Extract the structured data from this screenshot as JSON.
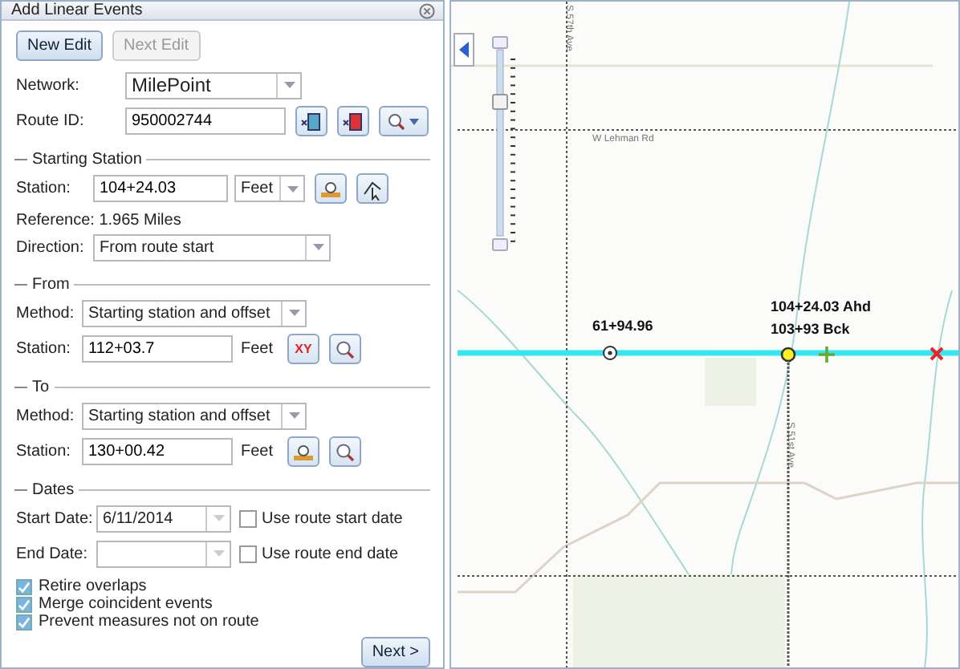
{
  "panel": {
    "title": "Add Linear Events",
    "edit_buttons": [
      {
        "label": "New Edit",
        "disabled": false
      },
      {
        "label": "Next Edit",
        "disabled": true
      }
    ],
    "network": {
      "label": "Network:",
      "value": "MilePoint"
    },
    "route": {
      "label": "Route ID:",
      "value": "950002744"
    },
    "starting_station": {
      "heading": "Starting Station",
      "station_label": "Station:",
      "station": "104+24.03",
      "unit": "Feet",
      "reference": "Reference: 1.965 Miles",
      "direction_label": "Direction:",
      "direction": "From route start"
    },
    "ends": [
      {
        "heading": "From",
        "method_label": "Method:",
        "method": "Starting station and offset",
        "station_label": "Station:",
        "station": "112+03.7",
        "unit": "Feet",
        "tool": "XY"
      },
      {
        "heading": "To",
        "method_label": "Method:",
        "method": "Starting station and offset",
        "station_label": "Station:",
        "station": "130+00.42",
        "unit": "Feet"
      }
    ],
    "dates": {
      "heading": "Dates",
      "rows": [
        {
          "label": "Start Date:",
          "value": "6/11/2014",
          "option": "Use route start date",
          "checked": false
        },
        {
          "label": "End Date:",
          "value": "",
          "option": "Use route end date",
          "checked": false
        }
      ]
    },
    "options": [
      {
        "label": "Retire overlaps",
        "checked": true
      },
      {
        "label": "Merge coincident events",
        "checked": true
      },
      {
        "label": "Prevent measures not on route",
        "checked": true
      }
    ],
    "next_button": "Next >"
  },
  "map": {
    "zoom_slider": {
      "level": 0.72
    },
    "road_labels": [
      {
        "text": "W Lehman Rd",
        "kind": "horizontal"
      },
      {
        "text": "S 57th Ave",
        "kind": "vertical-top"
      },
      {
        "text": "S 51st Ave",
        "kind": "vertical-bottom"
      }
    ],
    "station_labels": [
      "61+94.96",
      "104+24.03 Ahd",
      "103+93 Bck"
    ]
  }
}
